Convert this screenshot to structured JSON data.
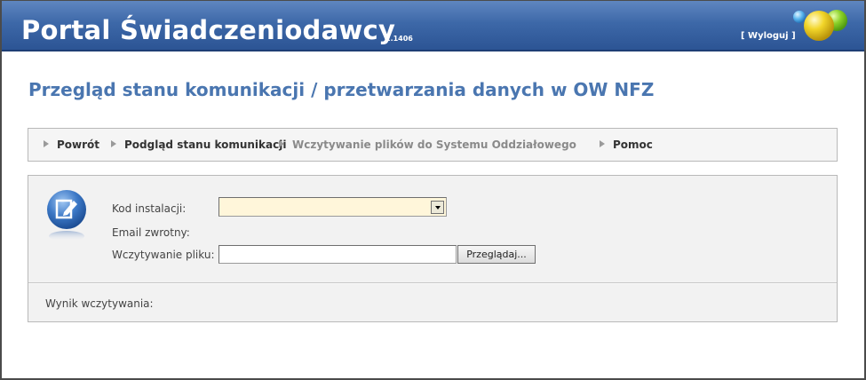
{
  "header": {
    "app_title": "Portal Świadczeniodawcy",
    "version": "2.1406",
    "logout_label": "[ Wyloguj ]"
  },
  "page": {
    "title": "Przegląd stanu komunikacji / przetwarzania danych w OW NFZ"
  },
  "nav": {
    "items": [
      {
        "label": "Powrót",
        "active": true
      },
      {
        "label": "Podgląd stanu komunikacji",
        "active": true
      },
      {
        "label": "Wczytywanie plików do Systemu Oddziałowego",
        "active": false
      },
      {
        "label": "Pomoc",
        "active": true
      }
    ]
  },
  "form": {
    "kod_instalacji_label": "Kod instalacji:",
    "kod_instalacji_value": "",
    "email_label": "Email zwrotny:",
    "file_label": "Wczytywanie pliku:",
    "file_value": "",
    "browse_label": "Przeglądaj...",
    "result_label": "Wynik wczytywania:"
  },
  "colors": {
    "header_blue": "#3d68a8",
    "title_blue": "#4a76b0",
    "select_bg": "#fff6da"
  },
  "icons": [
    "logo-balls-icon",
    "edit-document-icon",
    "dropdown-arrow-icon",
    "nav-arrow-icon"
  ]
}
